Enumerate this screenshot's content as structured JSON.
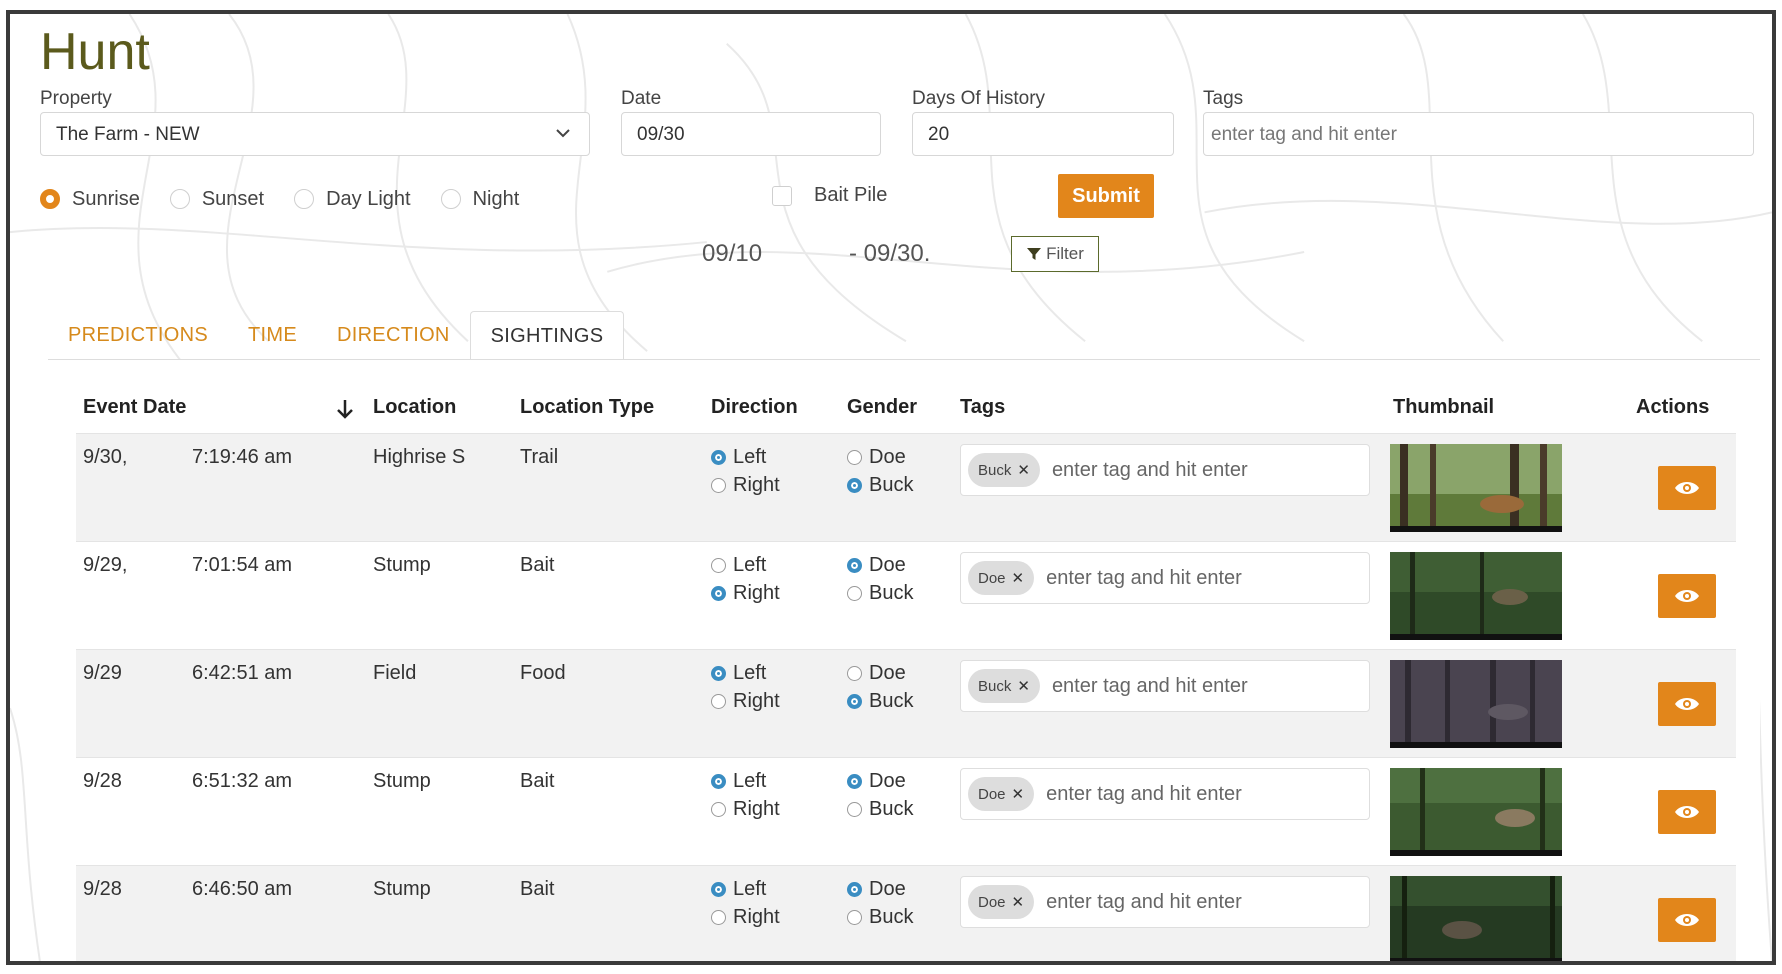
{
  "page": {
    "title": "Hunt"
  },
  "form": {
    "property_label": "Property",
    "property_value": "The Farm - NEW",
    "date_label": "Date",
    "date_value": "09/30",
    "days_label": "Days Of History",
    "days_value": "20",
    "tags_label": "Tags",
    "tags_placeholder": "enter tag and hit enter",
    "time_options": [
      {
        "label": "Sunrise",
        "selected": true
      },
      {
        "label": "Sunset",
        "selected": false
      },
      {
        "label": "Day Light",
        "selected": false
      },
      {
        "label": "Night",
        "selected": false
      }
    ],
    "bait_label": "Bait Pile",
    "bait_checked": false,
    "submit_label": "Submit",
    "range_start": "09/10",
    "range_end": "- 09/30.",
    "filter_label": "Filter"
  },
  "tabs": [
    {
      "label": "PREDICTIONS",
      "active": false
    },
    {
      "label": "TIME",
      "active": false
    },
    {
      "label": "DIRECTION",
      "active": false
    },
    {
      "label": "SIGHTINGS",
      "active": true
    }
  ],
  "table": {
    "headers": {
      "event_date": "Event Date",
      "location": "Location",
      "location_type": "Location Type",
      "direction": "Direction",
      "gender": "Gender",
      "tags": "Tags",
      "thumbnail": "Thumbnail",
      "actions": "Actions"
    },
    "direction_left": "Left",
    "direction_right": "Right",
    "gender_doe": "Doe",
    "gender_buck": "Buck",
    "tag_placeholder": "enter tag and hit enter",
    "rows": [
      {
        "date": "9/30,",
        "time": "7:19:46 am",
        "location": "Highrise S",
        "type": "Trail",
        "direction": "Left",
        "gender": "Buck",
        "tag": "Buck"
      },
      {
        "date": "9/29,",
        "time": "7:01:54 am",
        "location": "Stump",
        "type": "Bait",
        "direction": "Right",
        "gender": "Doe",
        "tag": "Doe"
      },
      {
        "date": "9/29",
        "time": "6:42:51 am",
        "location": "Field",
        "type": "Food",
        "direction": "Left",
        "gender": "Buck",
        "tag": "Buck"
      },
      {
        "date": "9/28",
        "time": "6:51:32 am",
        "location": "Stump",
        "type": "Bait",
        "direction": "Left",
        "gender": "Doe",
        "tag": "Doe"
      },
      {
        "date": "9/28",
        "time": "6:46:50 am",
        "location": "Stump",
        "type": "Bait",
        "direction": "Left",
        "gender": "Doe",
        "tag": "Doe"
      }
    ]
  },
  "colors": {
    "accent": "#e2861b",
    "title": "#5b5a1c",
    "radio_selected": "#3a8dc2"
  }
}
